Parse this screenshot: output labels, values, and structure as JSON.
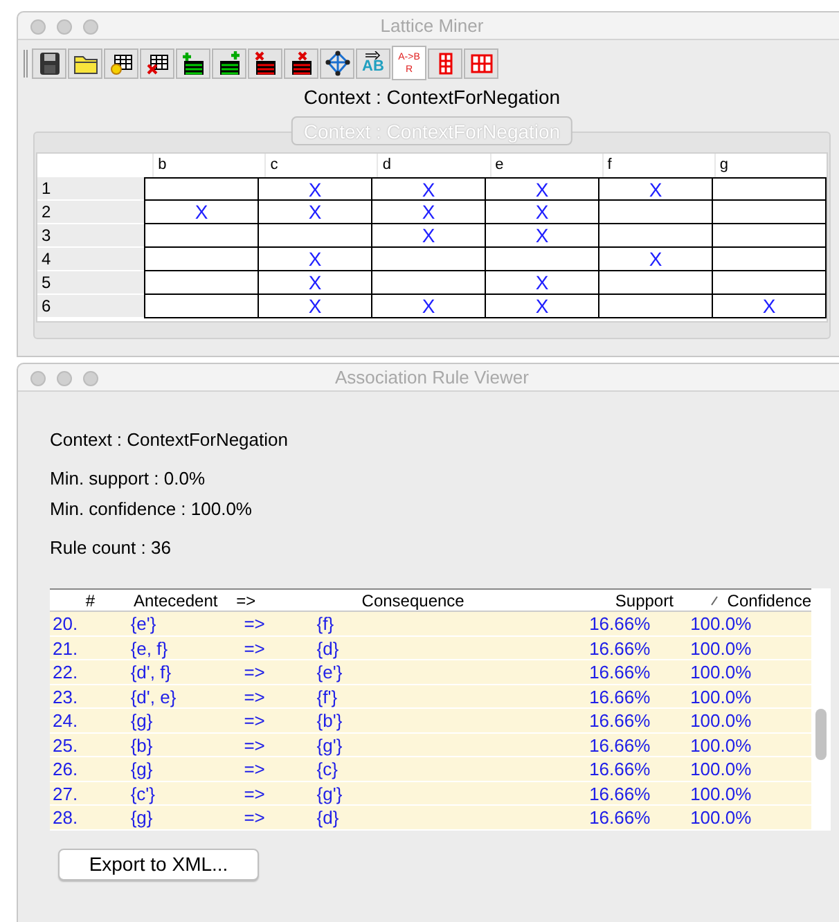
{
  "main_window": {
    "title": "Lattice Miner"
  },
  "toolbar": [
    {
      "kind": "save",
      "pressed": false
    },
    {
      "kind": "open",
      "pressed": false
    },
    {
      "kind": "new-table",
      "pressed": false
    },
    {
      "kind": "delete-table",
      "pressed": false
    },
    {
      "kind": "add-row",
      "pressed": false
    },
    {
      "kind": "add-column",
      "pressed": false
    },
    {
      "kind": "remove-row",
      "pressed": false
    },
    {
      "kind": "remove-column",
      "pressed": false
    },
    {
      "kind": "lattice",
      "pressed": false
    },
    {
      "kind": "rename",
      "pressed": false,
      "text": "AB"
    },
    {
      "kind": "rules",
      "pressed": true,
      "text": "A->B",
      "subtext": "R"
    },
    {
      "kind": "grid-columns",
      "pressed": false
    },
    {
      "kind": "grid",
      "pressed": false
    }
  ],
  "context_label": "Context : ContextForNegation",
  "context_tab": {
    "label": "Context : ContextForNegation",
    "disabled": true
  },
  "context_table": {
    "columns": [
      "b",
      "c",
      "d",
      "e",
      "f",
      "g"
    ],
    "rows": [
      {
        "label": "1",
        "cells": [
          null,
          "X",
          "X",
          "X",
          "X",
          null
        ]
      },
      {
        "label": "2",
        "cells": [
          "X",
          "X",
          "X",
          "X",
          null,
          null
        ]
      },
      {
        "label": "3",
        "cells": [
          null,
          null,
          "X",
          "X",
          null,
          null
        ]
      },
      {
        "label": "4",
        "cells": [
          null,
          "X",
          null,
          null,
          "X",
          null
        ]
      },
      {
        "label": "5",
        "cells": [
          null,
          "X",
          null,
          "X",
          null,
          null
        ]
      },
      {
        "label": "6",
        "cells": [
          null,
          "X",
          "X",
          "X",
          null,
          "X"
        ]
      }
    ]
  },
  "rule_window": {
    "title": "Association Rule Viewer",
    "context": "Context : ContextForNegation",
    "min_support": "Min. support : 0.0%",
    "min_confidence": "Min. confidence : 100.0%",
    "rule_count": "Rule count : 36",
    "columns": [
      {
        "label": "#",
        "sorted": false
      },
      {
        "label": "Antecedent",
        "sorted": false
      },
      {
        "label": "=>",
        "sorted": false
      },
      {
        "label": "Consequence",
        "sorted": false
      },
      {
        "label": "Support",
        "sorted": false
      },
      {
        "label": "Confidence",
        "sorted": true
      }
    ],
    "rows": [
      [
        "20.",
        "{e'}",
        "=>",
        "{f}",
        "16.66%",
        "100.0%"
      ],
      [
        "21.",
        "{e, f}",
        "=>",
        "{d}",
        "16.66%",
        "100.0%"
      ],
      [
        "22.",
        "{d', f}",
        "=>",
        "{e'}",
        "16.66%",
        "100.0%"
      ],
      [
        "23.",
        "{d', e}",
        "=>",
        "{f'}",
        "16.66%",
        "100.0%"
      ],
      [
        "24.",
        "{g}",
        "=>",
        "{b'}",
        "16.66%",
        "100.0%"
      ],
      [
        "25.",
        "{b}",
        "=>",
        "{g'}",
        "16.66%",
        "100.0%"
      ],
      [
        "26.",
        "{g}",
        "=>",
        "{c}",
        "16.66%",
        "100.0%"
      ],
      [
        "27.",
        "{c'}",
        "=>",
        "{g'}",
        "16.66%",
        "100.0%"
      ],
      [
        "28.",
        "{g}",
        "=>",
        "{d}",
        "16.66%",
        "100.0%"
      ]
    ],
    "export_button": "Export to XML..."
  }
}
